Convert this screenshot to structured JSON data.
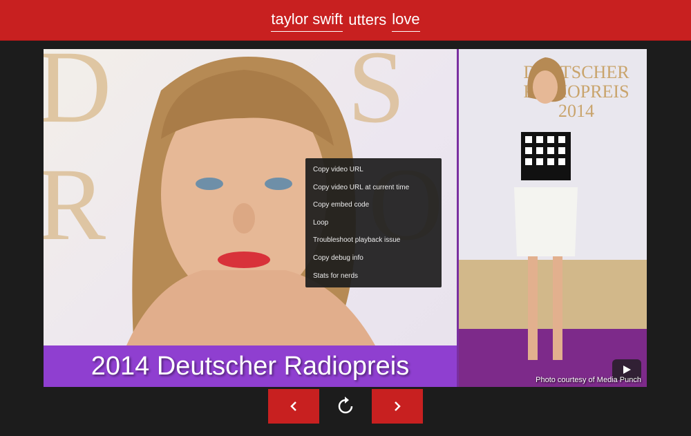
{
  "header": {
    "words": [
      "taylor swift",
      "utters",
      "love"
    ]
  },
  "player": {
    "left_photo": {
      "background_text": "DS R O",
      "caption": "2014 Deutscher Radiopreis"
    },
    "right_photo": {
      "sign_text": "DEUTSCHER RADIOPREIS 2014",
      "credit": "Photo courtesy of Media Punch"
    },
    "context_menu": [
      "Copy video URL",
      "Copy video URL at current time",
      "Copy embed code",
      "Loop",
      "Troubleshoot playback issue",
      "Copy debug info",
      "Stats for nerds"
    ]
  },
  "colors": {
    "brand_red": "#c82020",
    "caption_purple": "#8f3fd0",
    "background": "#1c1c1c"
  },
  "icons": {
    "prev": "chevron-left-icon",
    "refresh": "refresh-icon",
    "next": "chevron-right-icon",
    "play": "play-icon"
  }
}
